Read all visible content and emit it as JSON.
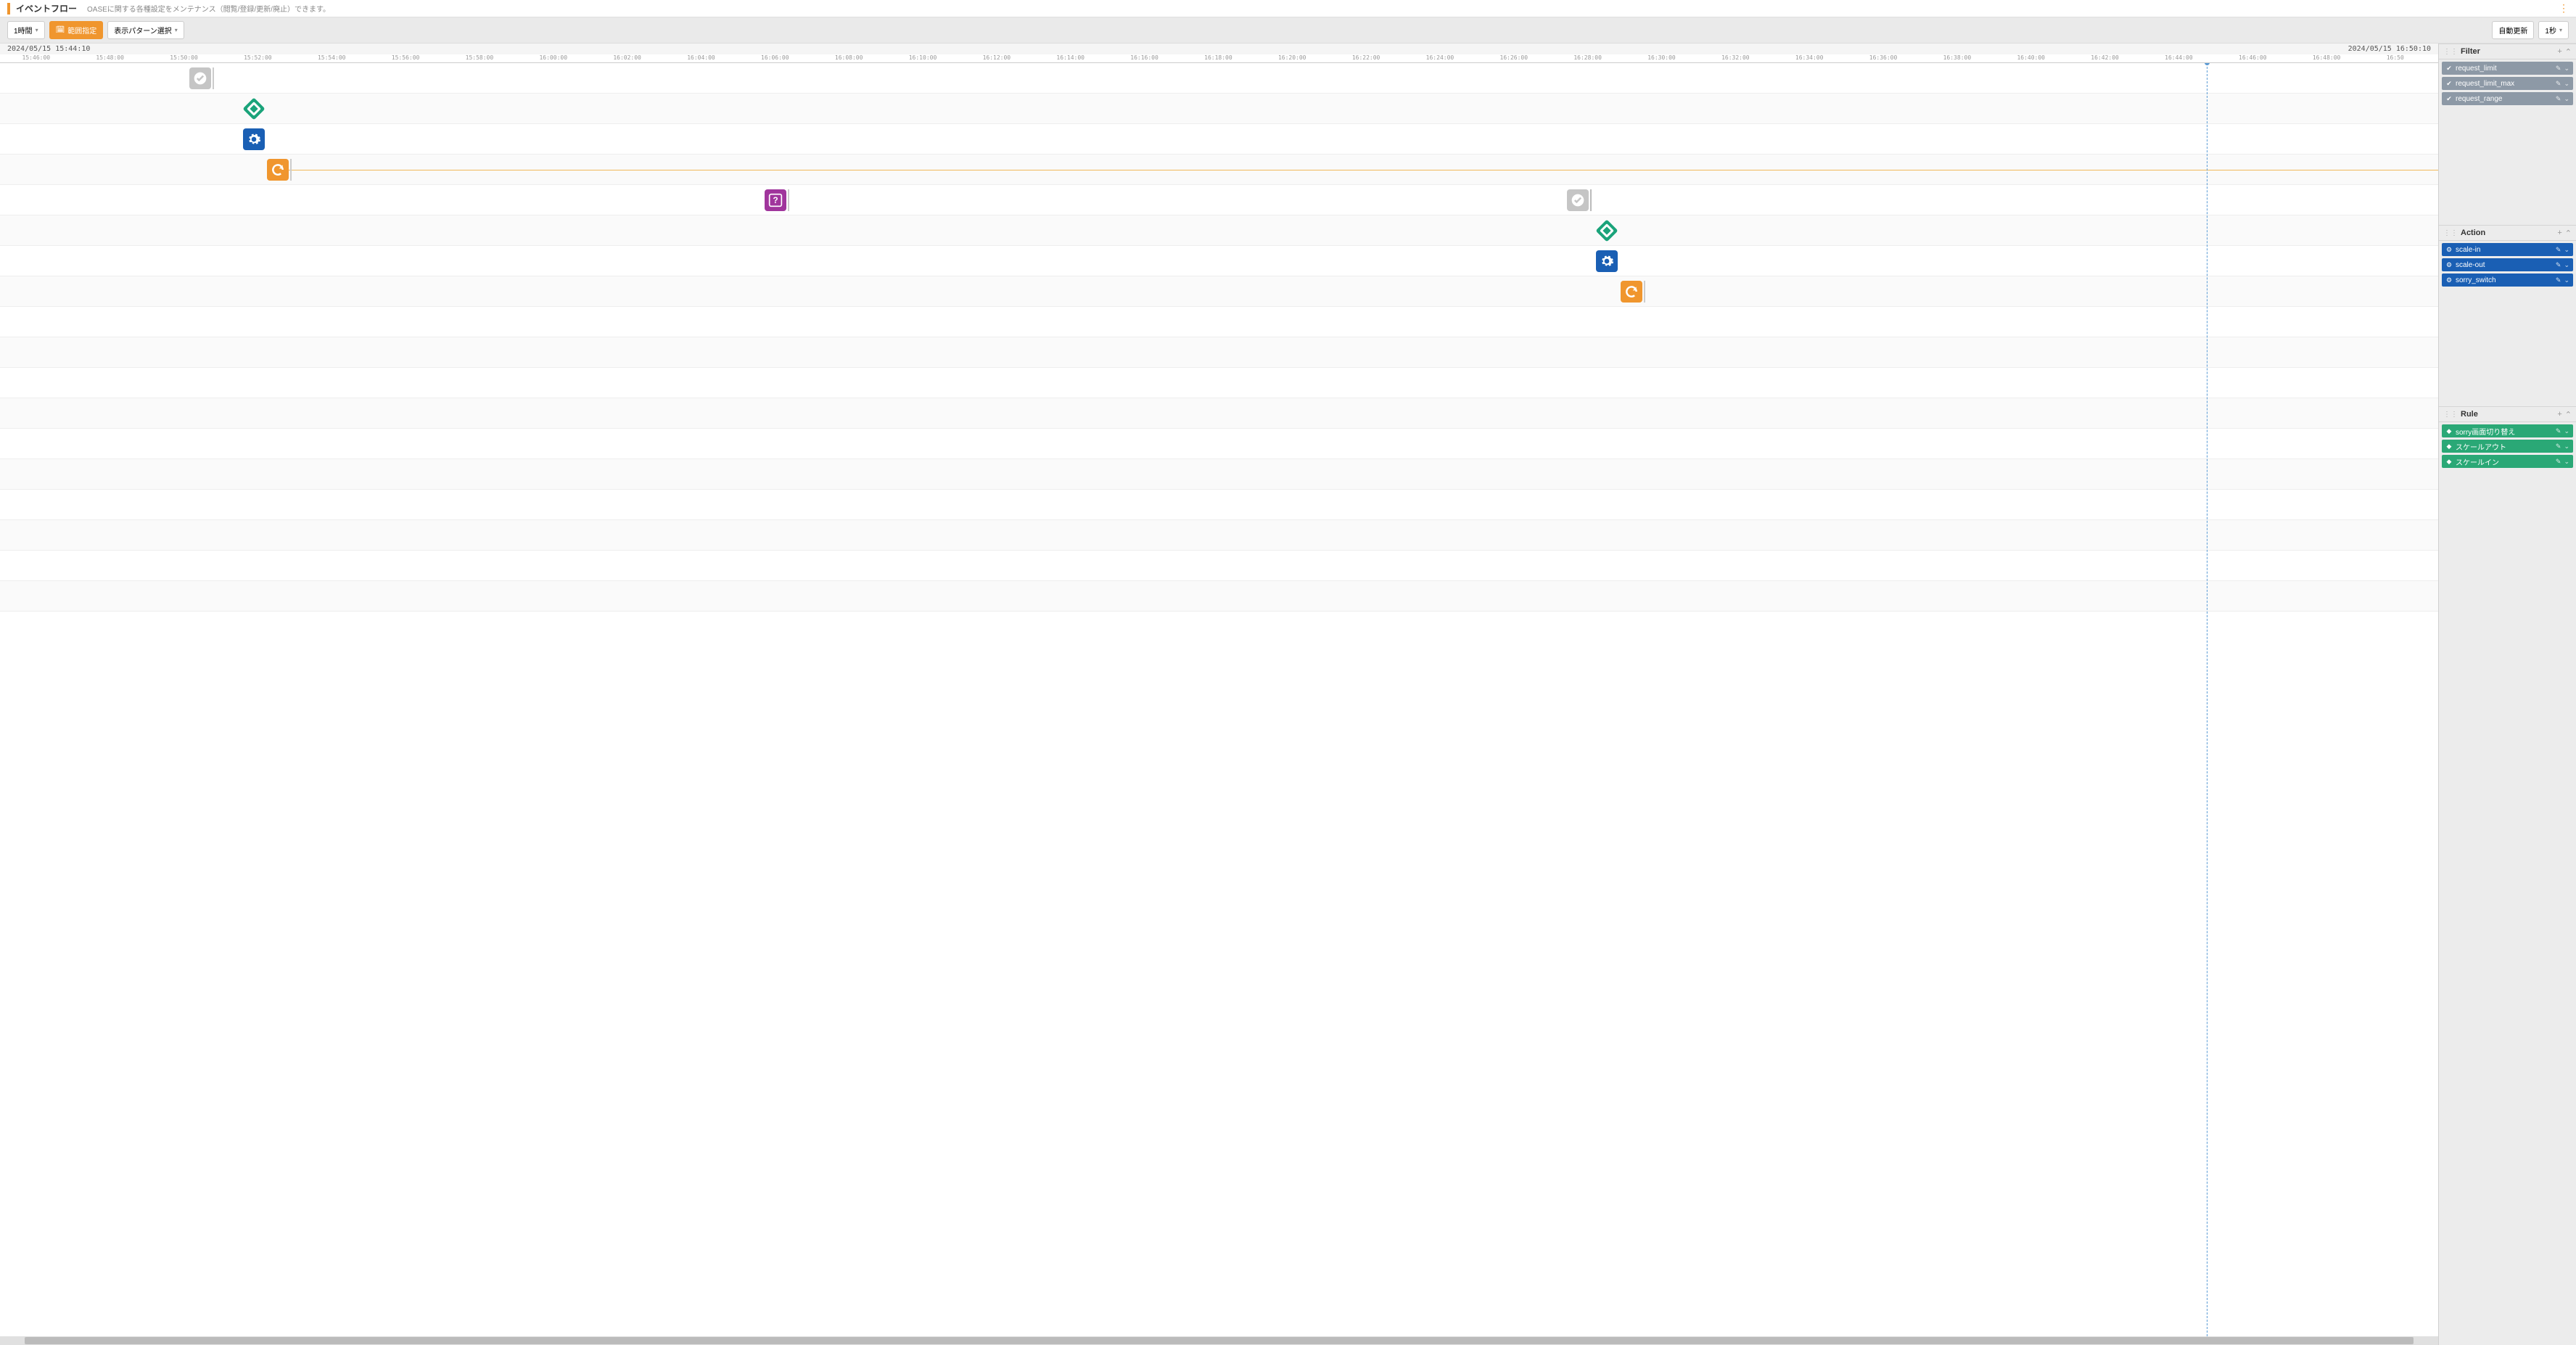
{
  "header": {
    "title": "イベントフロー",
    "description": "OASEに関する各種設定をメンテナンス（閲覧/登録/更新/廃止）できます。"
  },
  "toolbar": {
    "duration_label": "1時間",
    "range_button": "範囲指定",
    "pattern_button": "表示パターン選択",
    "auto_refresh_label": "自動更新",
    "auto_refresh_value": "1秒"
  },
  "time_range": {
    "start": "2024/05/15 15:44:10",
    "end": "2024/05/15 16:50:10",
    "now_fraction": 0.905
  },
  "ruler_ticks": [
    "15:46:00",
    "15:48:00",
    "15:50:00",
    "15:52:00",
    "15:54:00",
    "15:56:00",
    "15:58:00",
    "16:00:00",
    "16:02:00",
    "16:04:00",
    "16:06:00",
    "16:08:00",
    "16:10:00",
    "16:12:00",
    "16:14:00",
    "16:16:00",
    "16:18:00",
    "16:20:00",
    "16:22:00",
    "16:24:00",
    "16:26:00",
    "16:28:00",
    "16:30:00",
    "16:32:00",
    "16:34:00",
    "16:36:00",
    "16:38:00",
    "16:40:00",
    "16:42:00",
    "16:44:00",
    "16:46:00",
    "16:48:00",
    "16:50"
  ],
  "lanes_count": 18,
  "events": [
    {
      "lane": 0,
      "x": 0.082,
      "type": "check",
      "tick_after": true
    },
    {
      "lane": 1,
      "x": 0.104,
      "type": "diamond"
    },
    {
      "lane": 2,
      "x": 0.104,
      "type": "gear"
    },
    {
      "lane": 3,
      "x": 0.114,
      "type": "refresh",
      "tick_after": true,
      "line_to": 1.0,
      "line_color": "#f0b95a"
    },
    {
      "lane": 4,
      "x": 0.318,
      "type": "question",
      "tick_after": true
    },
    {
      "lane": 4,
      "x": 0.647,
      "type": "check",
      "tick_after": true,
      "tick_color": "#bbb"
    },
    {
      "lane": 5,
      "x": 0.659,
      "type": "diamond"
    },
    {
      "lane": 6,
      "x": 0.659,
      "type": "gear"
    },
    {
      "lane": 7,
      "x": 0.669,
      "type": "refresh",
      "tick_after": true
    }
  ],
  "sidebar": {
    "filter": {
      "title": "Filter",
      "items": [
        {
          "label": "request_limit"
        },
        {
          "label": "request_limit_max"
        },
        {
          "label": "request_range"
        }
      ]
    },
    "action": {
      "title": "Action",
      "items": [
        {
          "label": "scale-in"
        },
        {
          "label": "scale-out"
        },
        {
          "label": "sorry_switch"
        }
      ]
    },
    "rule": {
      "title": "Rule",
      "items": [
        {
          "label": "sorry画面切り替え"
        },
        {
          "label": "スケールアウト"
        },
        {
          "label": "スケールイン"
        }
      ]
    }
  }
}
